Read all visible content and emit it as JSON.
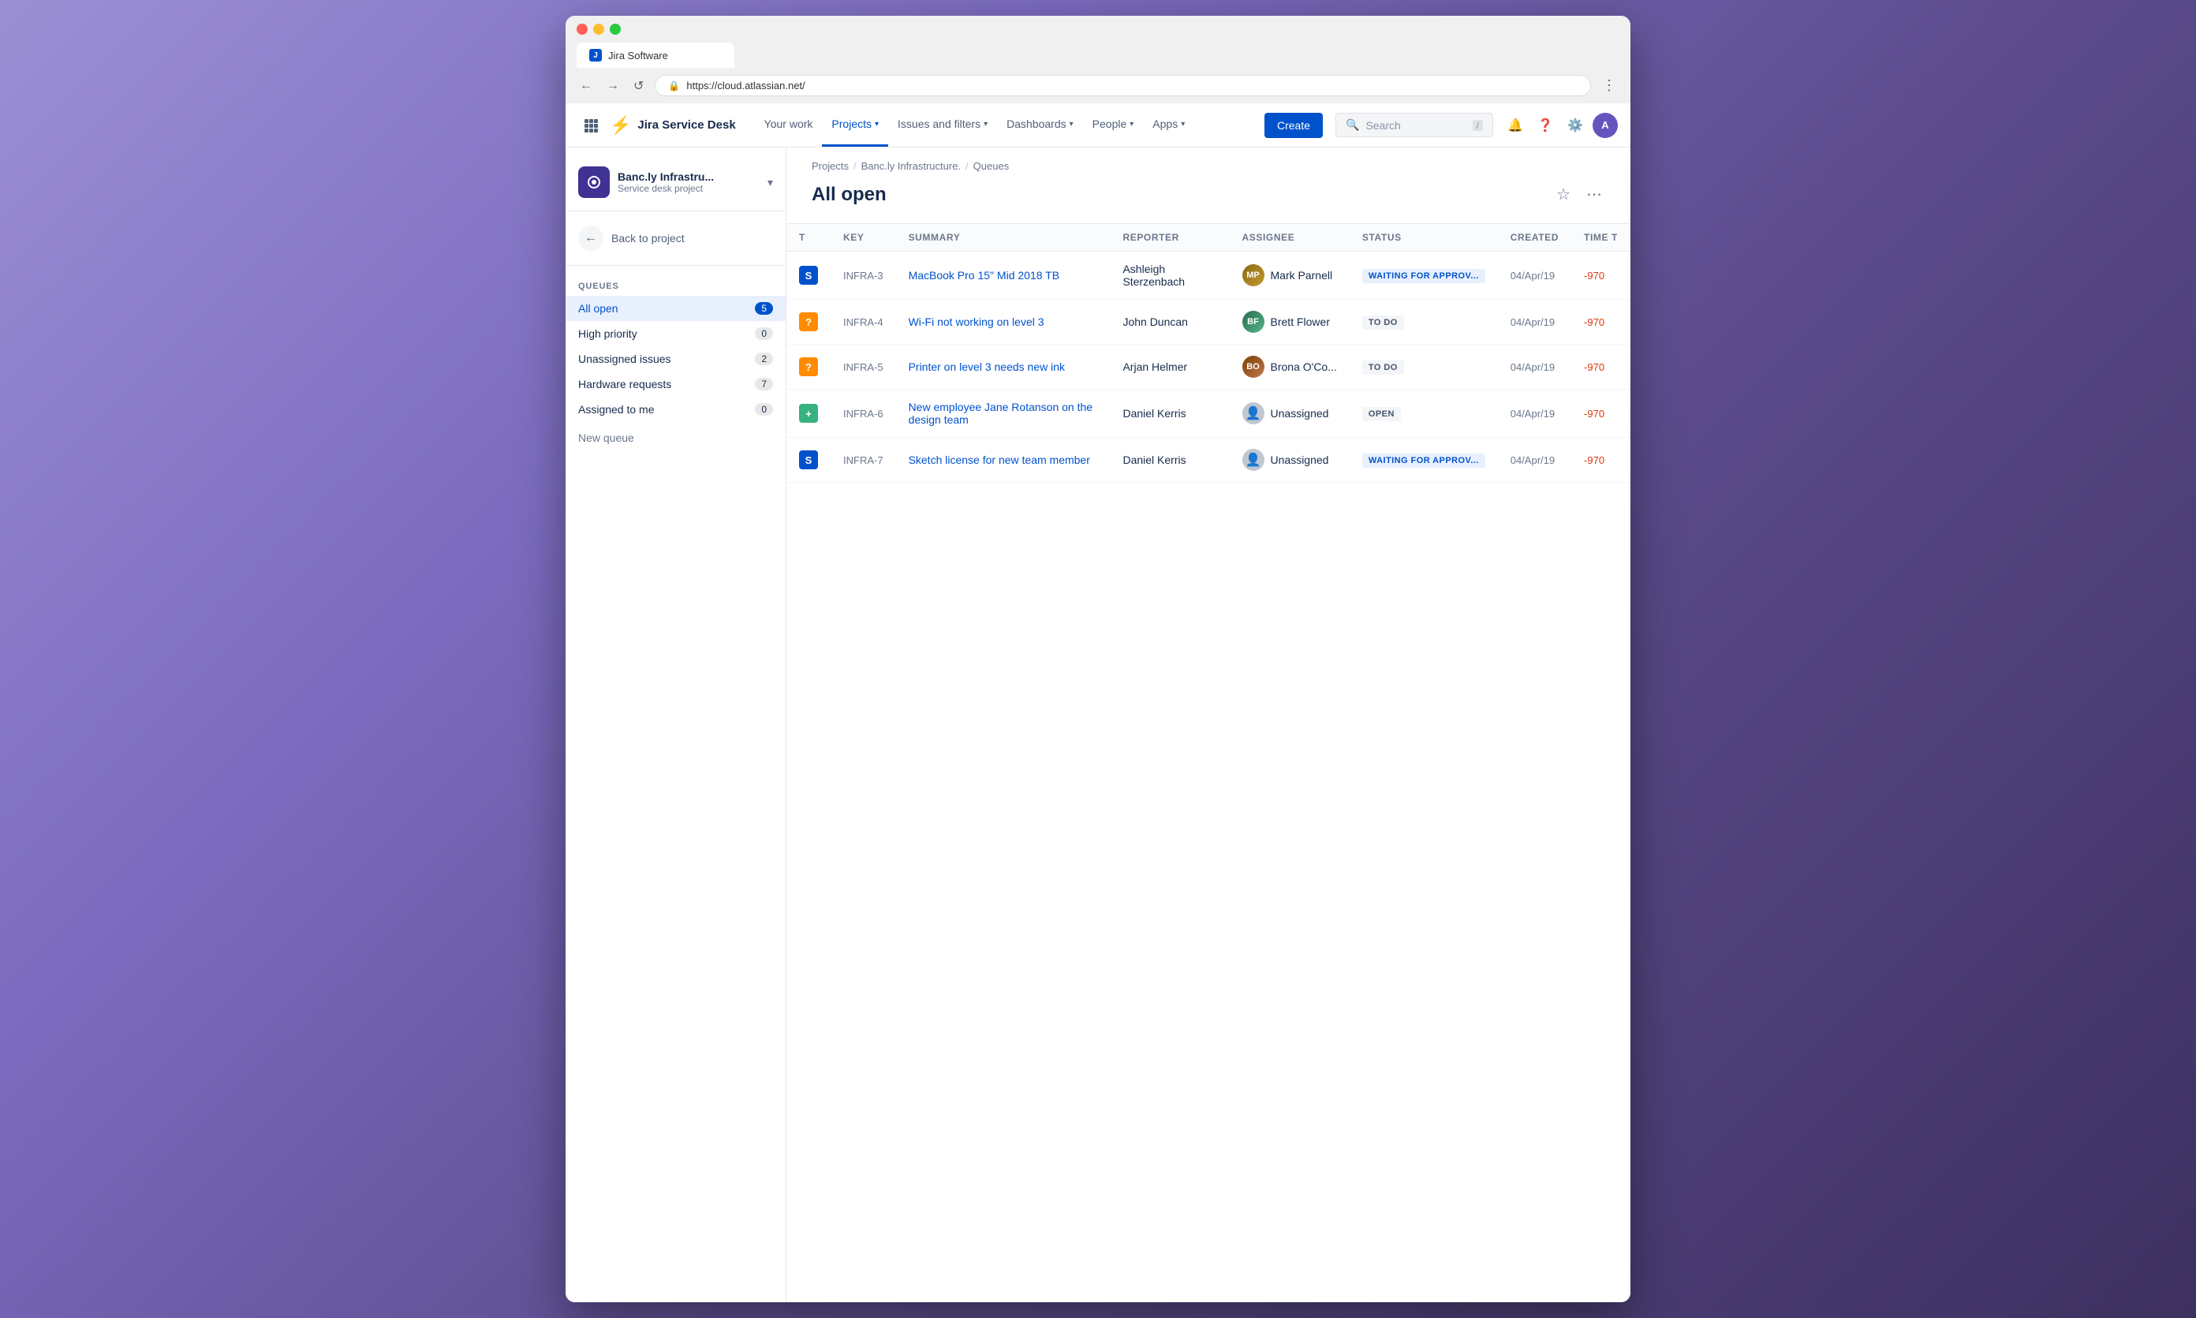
{
  "browser": {
    "tab_label": "Jira Software",
    "url": "https://cloud.atlassian.net/",
    "nav_back": "←",
    "nav_forward": "→",
    "nav_reload": "↺"
  },
  "topnav": {
    "logo_text": "Jira Service Desk",
    "links": [
      {
        "id": "your-work",
        "label": "Your work",
        "has_chevron": false,
        "active": false
      },
      {
        "id": "projects",
        "label": "Projects",
        "has_chevron": true,
        "active": true
      },
      {
        "id": "issues",
        "label": "Issues and filters",
        "has_chevron": true,
        "active": false
      },
      {
        "id": "dashboards",
        "label": "Dashboards",
        "has_chevron": true,
        "active": false
      },
      {
        "id": "people",
        "label": "People",
        "has_chevron": true,
        "active": false
      },
      {
        "id": "apps",
        "label": "Apps",
        "has_chevron": true,
        "active": false
      }
    ],
    "create_label": "Create",
    "search_placeholder": "Search",
    "search_shortcut": "/"
  },
  "sidebar": {
    "project_name": "Banc.ly Infrastru...",
    "project_type": "Service desk project",
    "back_label": "Back to project",
    "section_title": "Queues",
    "items": [
      {
        "id": "all-open",
        "label": "All open",
        "count": "5",
        "active": true
      },
      {
        "id": "high-priority",
        "label": "High priority",
        "count": "0",
        "active": false
      },
      {
        "id": "unassigned",
        "label": "Unassigned issues",
        "count": "2",
        "active": false
      },
      {
        "id": "hardware",
        "label": "Hardware requests",
        "count": "7",
        "active": false
      },
      {
        "id": "assigned-me",
        "label": "Assigned to me",
        "count": "0",
        "active": false
      }
    ],
    "new_queue_label": "New queue"
  },
  "content": {
    "breadcrumb": {
      "parts": [
        "Projects",
        "Banc.ly Infrastructure.",
        "Queues"
      ]
    },
    "title": "All open",
    "columns": [
      "T",
      "Key",
      "Summary",
      "Reporter",
      "Assignee",
      "Status",
      "Created",
      "Time t"
    ],
    "issues": [
      {
        "id": "infra-3",
        "type": "service",
        "type_label": "S",
        "key": "INFRA-3",
        "summary": "MacBook Pro 15\" Mid 2018 TB",
        "reporter": "Ashleigh Sterzenbach",
        "assignee": "Mark Parnell",
        "assignee_initials": "MP",
        "assignee_type": "person",
        "status": "WAITING FOR APPROV...",
        "status_type": "waiting",
        "created": "04/Apr/19",
        "time": "-970"
      },
      {
        "id": "infra-4",
        "type": "question",
        "type_label": "?",
        "key": "INFRA-4",
        "summary": "Wi-Fi not working on level 3",
        "reporter": "John Duncan",
        "assignee": "Brett Flower",
        "assignee_initials": "BF",
        "assignee_type": "person",
        "status": "TO DO",
        "status_type": "todo",
        "created": "04/Apr/19",
        "time": "-970"
      },
      {
        "id": "infra-5",
        "type": "question",
        "type_label": "?",
        "key": "INFRA-5",
        "summary": "Printer on level 3 needs new ink",
        "reporter": "Arjan Helmer",
        "assignee": "Brona O'Co...",
        "assignee_initials": "BO",
        "assignee_type": "person",
        "status": "TO DO",
        "status_type": "todo",
        "created": "04/Apr/19",
        "time": "-970"
      },
      {
        "id": "infra-6",
        "type": "new",
        "type_label": "+",
        "key": "INFRA-6",
        "summary": "New employee Jane Rotanson on the design team",
        "reporter": "Daniel Kerris",
        "assignee": "Unassigned",
        "assignee_initials": "",
        "assignee_type": "unassigned",
        "status": "OPEN",
        "status_type": "open",
        "created": "04/Apr/19",
        "time": "-970"
      },
      {
        "id": "infra-7",
        "type": "service",
        "type_label": "S",
        "key": "INFRA-7",
        "summary": "Sketch license for new team member",
        "reporter": "Daniel Kerris",
        "assignee": "Unassigned",
        "assignee_initials": "",
        "assignee_type": "unassigned",
        "status": "WAITING FOR APPROV...",
        "status_type": "waiting",
        "created": "04/Apr/19",
        "time": "-970"
      }
    ]
  }
}
